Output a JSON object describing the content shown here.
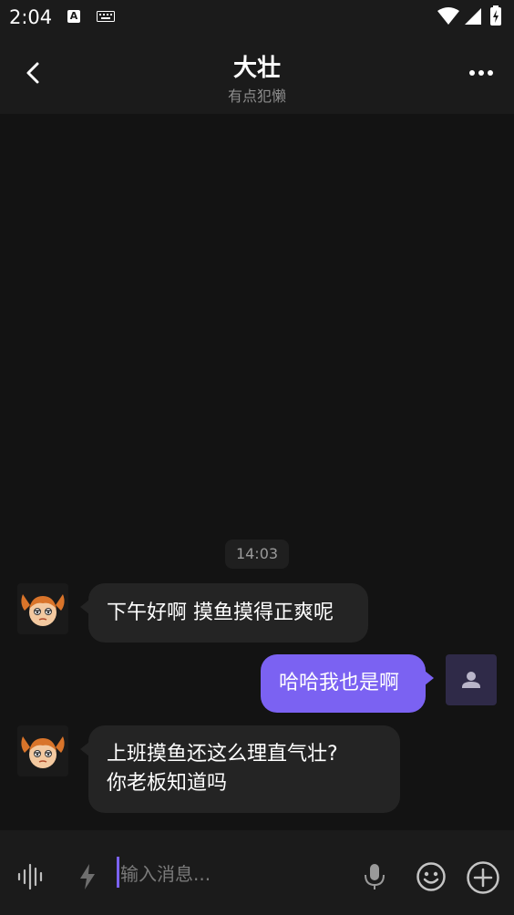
{
  "status_bar": {
    "time": "2:04",
    "notification_icon_letter": "A",
    "icons": [
      "keyboard-icon",
      "wifi-icon",
      "cell-signal-icon",
      "battery-charging-icon"
    ]
  },
  "header": {
    "title": "大壮",
    "subtitle": "有点犯懒"
  },
  "messages": {
    "timestamp": "14:03",
    "m1": "下午好啊 摸鱼摸得正爽呢",
    "m2": "哈哈我也是啊",
    "m3_line1": "上班摸鱼还这么理直气壮?",
    "m3_line2": "你老板知道吗"
  },
  "input": {
    "placeholder": "输入消息..."
  },
  "colors": {
    "accent": "#7b62f2",
    "background": "#131313",
    "bar": "#1b1b1b",
    "bubble_in": "#242424"
  }
}
